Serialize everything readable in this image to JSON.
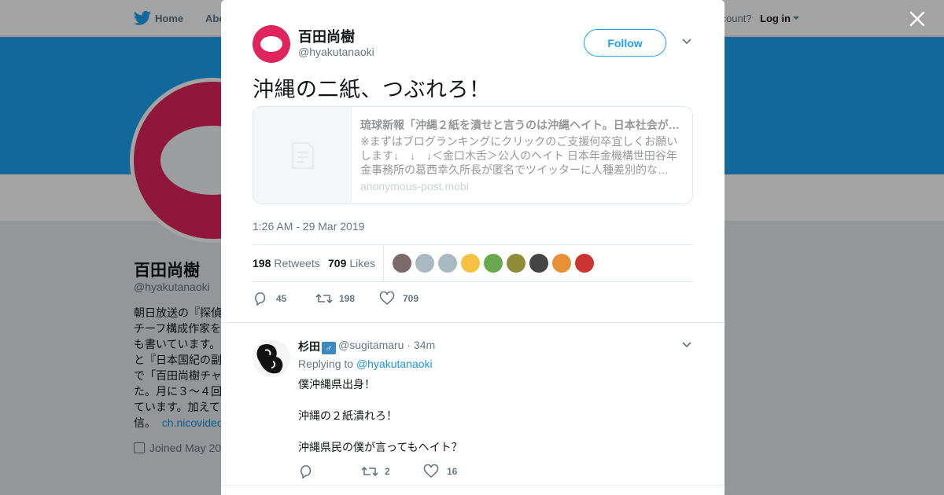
{
  "nav": {
    "home_label": "Home",
    "about_label": "Abo",
    "account_prompt": "ccount?",
    "login_label": "Log in"
  },
  "profile": {
    "name": "百田尚樹",
    "handle": "@hyakutanaoki",
    "bio_lines": [
      "朝日放送の『探偵",
      "チーフ構成作家を",
      "も書いています。",
      "と『日本国紀の副",
      "で「百田尚樹チャ",
      "た。月に３～４回",
      "ています。加えて",
      "信。"
    ],
    "bio_link": "ch.nicovideo",
    "joined": "Joined May 20"
  },
  "tweet": {
    "author_name": "百田尚樹",
    "author_handle": "@hyakutanaoki",
    "follow_label": "Follow",
    "text": "沖縄の二紙、つぶれろ！",
    "card": {
      "title": "琉球新報「沖縄２紙を潰せと言うのは沖縄ヘイト。日本社会が…",
      "description": "※まずはブログランキングにクリックのご支援何卒宜しくお願いします↓　↓　↓＜金口木舌＞公人のヘイト 日本年金機構世田谷年金事務所の葛西幸久所長が匿名でツイッターに人種差別的な…",
      "domain": "anonymous-post.mobi"
    },
    "timestamp": "1:26 AM - 29 Mar 2019",
    "retweets_count": "198",
    "retweets_label": "Retweets",
    "likes_count": "709",
    "likes_label": "Likes",
    "replies_action": "45",
    "retweets_action": "198",
    "likes_action": "709",
    "liker_avatar_colors": [
      "#7a6a6a",
      "#aab8c2",
      "#aab8c2",
      "#f5c243",
      "#6aa84f",
      "#8d8d3a",
      "#444444",
      "#e69138",
      "#cc3333"
    ]
  },
  "reply": {
    "author_name": "杉田",
    "author_emoji": "♂",
    "author_handle": "@sugitamaru",
    "time": "· 34m",
    "replying_to_label": "Replying to",
    "replying_to_handle": "@hyakutanaoki",
    "lines": [
      "僕沖縄県出身！",
      "沖縄の２紙潰れろ！",
      "沖縄県民の僕が言ってもヘイト？"
    ],
    "retweets": "2",
    "likes": "16"
  },
  "colors": {
    "accent": "#1da1f2",
    "brand_pink": "#e0245e",
    "link": "#1b95e0"
  }
}
